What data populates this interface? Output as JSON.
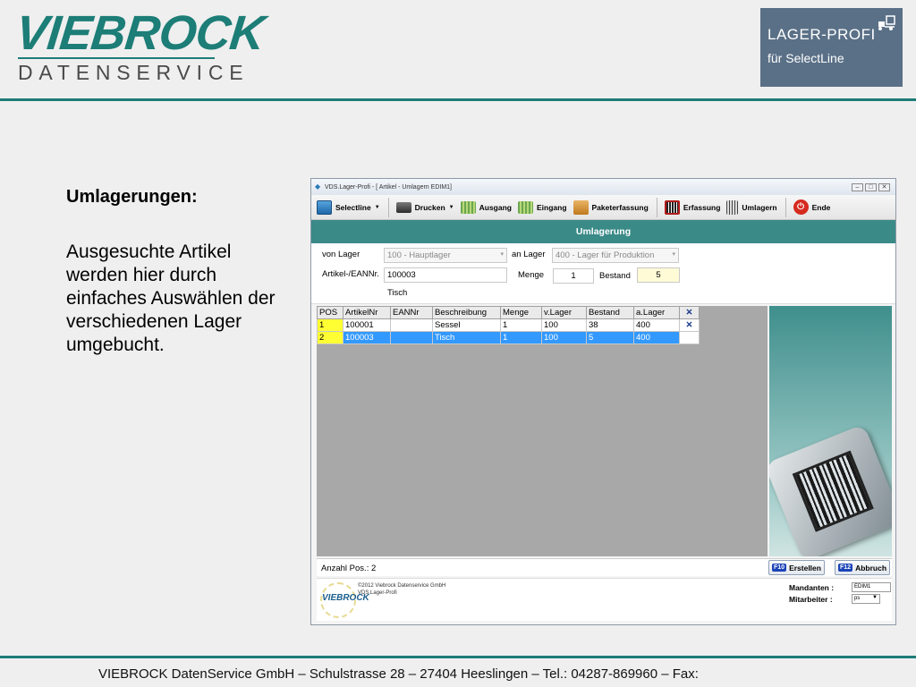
{
  "slide": {
    "logo_main": "VIEBROCK",
    "logo_sub": "DATENSERVICE",
    "badge_title": "LAGER-PROFI",
    "badge_subtitle": "für SelectLine",
    "heading": "Umlagerungen:",
    "description": "Ausgesuchte Artikel werden hier durch einfaches Auswählen der verschiedenen Lager umgebucht.",
    "footer": "VIEBROCK DatenService GmbH – Schulstrasse 28 – 27404 Heeslingen – Tel.: 04287-869960 – Fax:",
    "accent_color": "#1d7d77"
  },
  "window": {
    "title": "VDS.Lager-Profi - [ Artikel - Umlagern EDIM1]",
    "toolbar": [
      {
        "label": "Selectline",
        "icon": "selectline-icon",
        "dropdown": true
      },
      {
        "label": "Drucken",
        "icon": "printer-icon",
        "dropdown": true
      },
      {
        "label": "Ausgang",
        "icon": "outgoing-icon",
        "dropdown": false
      },
      {
        "label": "Eingang",
        "icon": "incoming-icon",
        "dropdown": false
      },
      {
        "label": "Paketerfassung",
        "icon": "package-icon",
        "dropdown": false
      },
      {
        "label": "Erfassung",
        "icon": "barcode-capture-icon",
        "dropdown": false
      },
      {
        "label": "Umlagern",
        "icon": "transfer-icon",
        "dropdown": false
      },
      {
        "label": "Ende",
        "icon": "power-icon",
        "dropdown": false
      }
    ],
    "banner": "Umlagerung",
    "form": {
      "von_lager_label": "von Lager",
      "von_lager_value": "100 - Hauptlager",
      "an_lager_label": "an Lager",
      "an_lager_value": "400 - Lager für Produktion",
      "artikel_label": "Artikel-/EANNr.",
      "artikel_value": "100003",
      "artikel_name": "Tisch",
      "menge_label": "Menge",
      "menge_value": "1",
      "bestand_label": "Bestand",
      "bestand_value": "5"
    },
    "table": {
      "columns": [
        "POS",
        "ArtikelNr",
        "EANNr",
        "Beschreibung",
        "Menge",
        "v.Lager",
        "Bestand",
        "a.Lager",
        "✕"
      ],
      "rows": [
        {
          "pos": "1",
          "artikel": "100001",
          "ean": "",
          "beschreibung": "Sessel",
          "menge": "1",
          "vlager": "100",
          "bestand": "38",
          "alager": "400",
          "selected": false
        },
        {
          "pos": "2",
          "artikel": "100003",
          "ean": "",
          "beschreibung": "Tisch",
          "menge": "1",
          "vlager": "100",
          "bestand": "5",
          "alager": "400",
          "selected": true
        }
      ]
    },
    "status": {
      "count": "Anzahl Pos.: 2",
      "btn_create_key": "F10",
      "btn_create": "Erstellen",
      "btn_cancel_key": "F12",
      "btn_cancel": "Abbruch"
    },
    "info": {
      "mini_logo": "VIEBROCK",
      "copyright": "©2012 Viebrock Datenservice GmbH",
      "product": "VDS.Lager-Profi",
      "mandant_label": "Mandanten :",
      "mandant_value": "EDIM1",
      "mitarbeiter_label": "Mitarbeiter :",
      "mitarbeiter_value": "ps"
    }
  }
}
